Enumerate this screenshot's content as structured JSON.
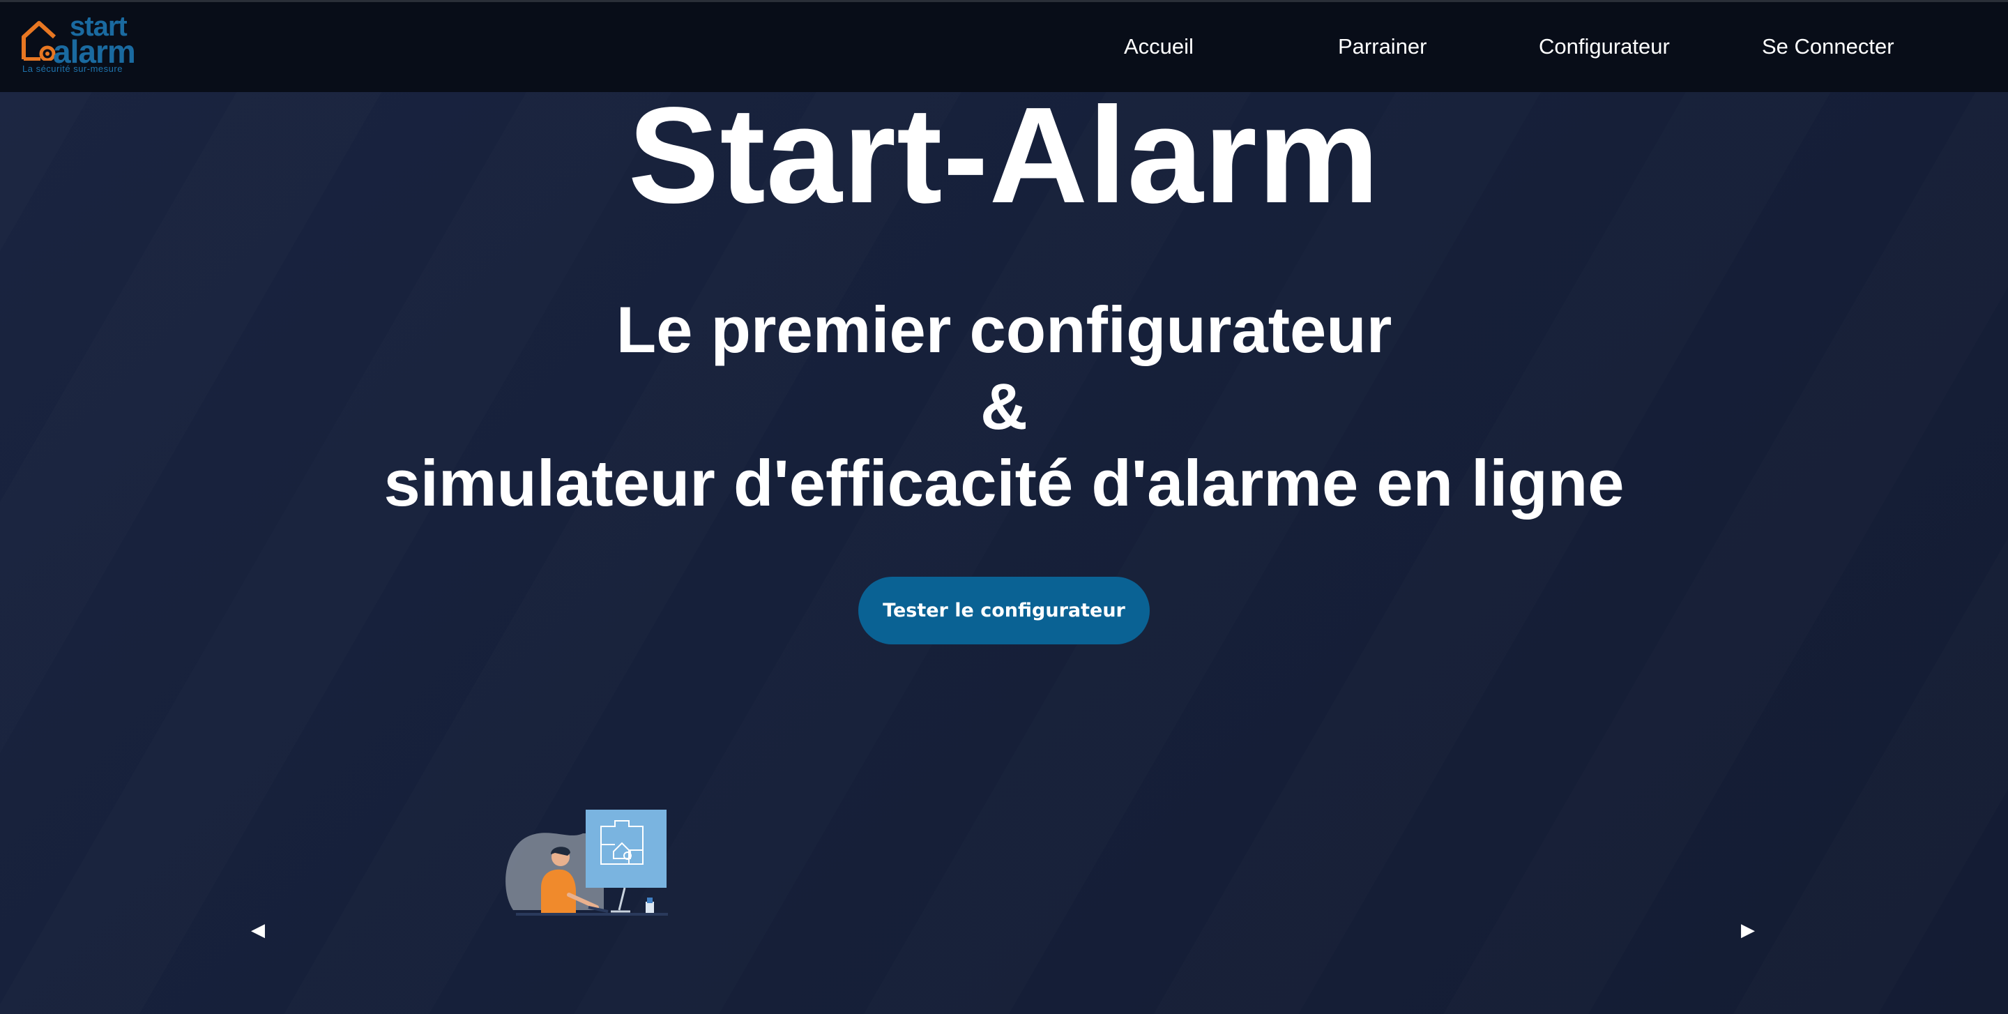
{
  "brand": {
    "logo_word1": "start",
    "logo_word2": "alarm",
    "tagline": "La sécurité sur-mesure",
    "accent_color": "#0a6294",
    "logo_orange": "#e87722"
  },
  "nav": {
    "items": [
      {
        "label": "Accueil"
      },
      {
        "label": "Parrainer"
      },
      {
        "label": "Configurateur"
      },
      {
        "label": "Se Connecter"
      }
    ]
  },
  "hero": {
    "title": "Start-Alarm",
    "subtitle_line1": "Le premier configurateur",
    "subtitle_line2": "&",
    "subtitle_line3": "simulateur d'efficacité d'alarme en ligne",
    "cta_label": "Tester le configurateur"
  },
  "carousel": {
    "prev_icon": "triangle-left-icon",
    "next_icon": "triangle-right-icon",
    "prev_glyph": "◀",
    "next_glyph": "▶",
    "slide_image": "person-at-computer-with-house-plan-illustration"
  }
}
